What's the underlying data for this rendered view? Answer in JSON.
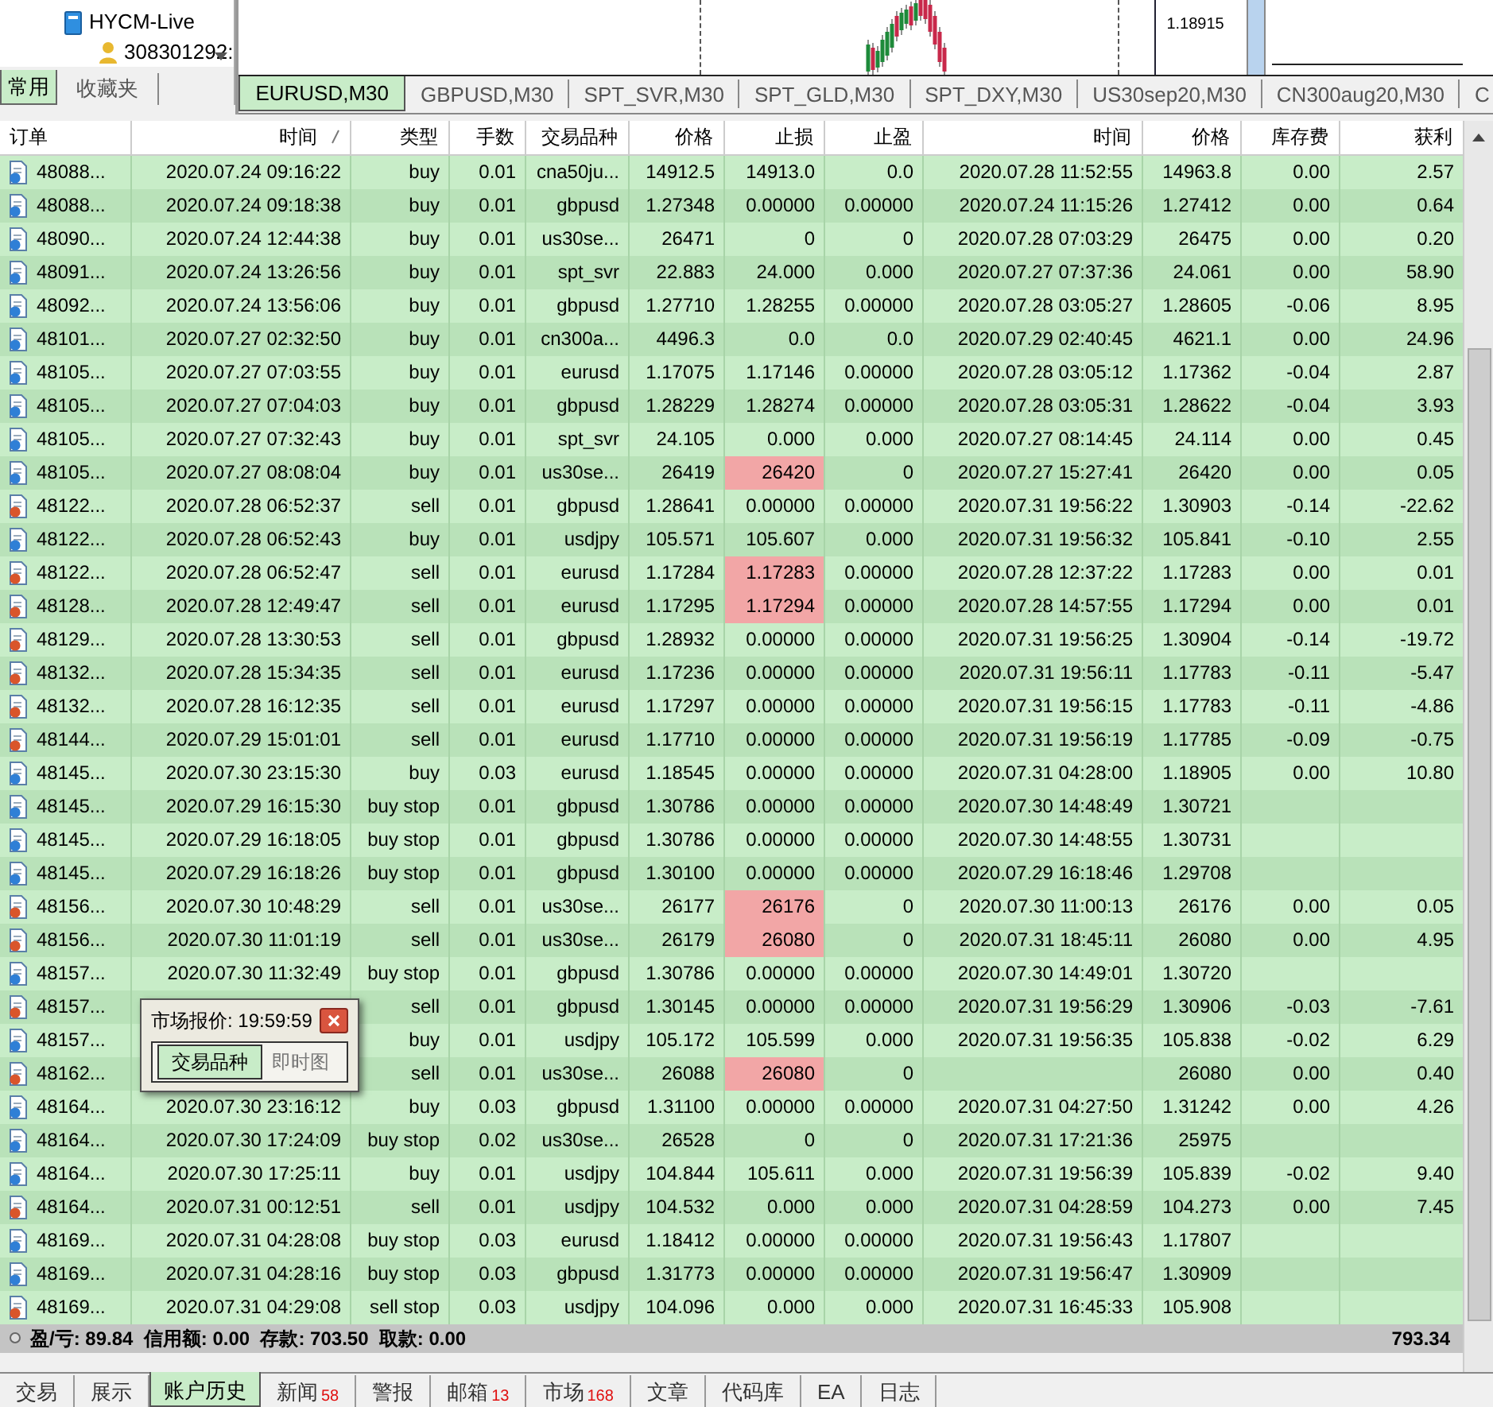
{
  "navigator": {
    "items": [
      {
        "label": "HYCM-Live",
        "kind": "server"
      },
      {
        "label": "308301292:",
        "kind": "account"
      }
    ],
    "tabs": [
      {
        "label": "常用",
        "selected": true
      },
      {
        "label": "收藏夹",
        "selected": false
      }
    ]
  },
  "chart": {
    "price_label": "1.18915"
  },
  "chart_tabs": [
    {
      "label": "EURUSD,M30",
      "selected": true
    },
    {
      "label": "GBPUSD,M30",
      "selected": false
    },
    {
      "label": "SPT_SVR,M30",
      "selected": false
    },
    {
      "label": "SPT_GLD,M30",
      "selected": false
    },
    {
      "label": "SPT_DXY,M30",
      "selected": false
    },
    {
      "label": "US30sep20,M30",
      "selected": false
    },
    {
      "label": "CN300aug20,M30",
      "selected": false
    },
    {
      "label": "C",
      "selected": false
    }
  ],
  "columns": [
    {
      "label": "订单",
      "sorted": false
    },
    {
      "label": "时间",
      "sorted": true
    },
    {
      "label": "类型",
      "sorted": false
    },
    {
      "label": "手数",
      "sorted": false
    },
    {
      "label": "交易品种",
      "sorted": false
    },
    {
      "label": "价格",
      "sorted": false
    },
    {
      "label": "止损",
      "sorted": false
    },
    {
      "label": "止盈",
      "sorted": false
    },
    {
      "label": "时间",
      "sorted": false
    },
    {
      "label": "价格",
      "sorted": false
    },
    {
      "label": "库存费",
      "sorted": false
    },
    {
      "label": "获利",
      "sorted": false
    }
  ],
  "rows": [
    {
      "kind": "buy",
      "order": "48088...",
      "time": "2020.07.24 09:16:22",
      "type": "buy",
      "lots": "0.01",
      "symbol": "cna50ju...",
      "price": "14912.5",
      "sl": "14913.0",
      "sl_hit": false,
      "tp": "0.0",
      "close_time": "2020.07.28 11:52:55",
      "close_price": "14963.8",
      "swap": "0.00",
      "profit": "2.57"
    },
    {
      "kind": "buy",
      "order": "48088...",
      "time": "2020.07.24 09:18:38",
      "type": "buy",
      "lots": "0.01",
      "symbol": "gbpusd",
      "price": "1.27348",
      "sl": "0.00000",
      "sl_hit": false,
      "tp": "0.00000",
      "close_time": "2020.07.24 11:15:26",
      "close_price": "1.27412",
      "swap": "0.00",
      "profit": "0.64"
    },
    {
      "kind": "buy",
      "order": "48090...",
      "time": "2020.07.24 12:44:38",
      "type": "buy",
      "lots": "0.01",
      "symbol": "us30se...",
      "price": "26471",
      "sl": "0",
      "sl_hit": false,
      "tp": "0",
      "close_time": "2020.07.28 07:03:29",
      "close_price": "26475",
      "swap": "0.00",
      "profit": "0.20"
    },
    {
      "kind": "buy",
      "order": "48091...",
      "time": "2020.07.24 13:26:56",
      "type": "buy",
      "lots": "0.01",
      "symbol": "spt_svr",
      "price": "22.883",
      "sl": "24.000",
      "sl_hit": false,
      "tp": "0.000",
      "close_time": "2020.07.27 07:37:36",
      "close_price": "24.061",
      "swap": "0.00",
      "profit": "58.90"
    },
    {
      "kind": "buy",
      "order": "48092...",
      "time": "2020.07.24 13:56:06",
      "type": "buy",
      "lots": "0.01",
      "symbol": "gbpusd",
      "price": "1.27710",
      "sl": "1.28255",
      "sl_hit": false,
      "tp": "0.00000",
      "close_time": "2020.07.28 03:05:27",
      "close_price": "1.28605",
      "swap": "-0.06",
      "profit": "8.95"
    },
    {
      "kind": "buy",
      "order": "48101...",
      "time": "2020.07.27 02:32:50",
      "type": "buy",
      "lots": "0.01",
      "symbol": "cn300a...",
      "price": "4496.3",
      "sl": "0.0",
      "sl_hit": false,
      "tp": "0.0",
      "close_time": "2020.07.29 02:40:45",
      "close_price": "4621.1",
      "swap": "0.00",
      "profit": "24.96"
    },
    {
      "kind": "buy",
      "order": "48105...",
      "time": "2020.07.27 07:03:55",
      "type": "buy",
      "lots": "0.01",
      "symbol": "eurusd",
      "price": "1.17075",
      "sl": "1.17146",
      "sl_hit": false,
      "tp": "0.00000",
      "close_time": "2020.07.28 03:05:12",
      "close_price": "1.17362",
      "swap": "-0.04",
      "profit": "2.87"
    },
    {
      "kind": "buy",
      "order": "48105...",
      "time": "2020.07.27 07:04:03",
      "type": "buy",
      "lots": "0.01",
      "symbol": "gbpusd",
      "price": "1.28229",
      "sl": "1.28274",
      "sl_hit": false,
      "tp": "0.00000",
      "close_time": "2020.07.28 03:05:31",
      "close_price": "1.28622",
      "swap": "-0.04",
      "profit": "3.93"
    },
    {
      "kind": "buy",
      "order": "48105...",
      "time": "2020.07.27 07:32:43",
      "type": "buy",
      "lots": "0.01",
      "symbol": "spt_svr",
      "price": "24.105",
      "sl": "0.000",
      "sl_hit": false,
      "tp": "0.000",
      "close_time": "2020.07.27 08:14:45",
      "close_price": "24.114",
      "swap": "0.00",
      "profit": "0.45"
    },
    {
      "kind": "buy",
      "order": "48105...",
      "time": "2020.07.27 08:08:04",
      "type": "buy",
      "lots": "0.01",
      "symbol": "us30se...",
      "price": "26419",
      "sl": "26420",
      "sl_hit": true,
      "tp": "0",
      "close_time": "2020.07.27 15:27:41",
      "close_price": "26420",
      "swap": "0.00",
      "profit": "0.05"
    },
    {
      "kind": "sell",
      "order": "48122...",
      "time": "2020.07.28 06:52:37",
      "type": "sell",
      "lots": "0.01",
      "symbol": "gbpusd",
      "price": "1.28641",
      "sl": "0.00000",
      "sl_hit": false,
      "tp": "0.00000",
      "close_time": "2020.07.31 19:56:22",
      "close_price": "1.30903",
      "swap": "-0.14",
      "profit": "-22.62"
    },
    {
      "kind": "buy",
      "order": "48122...",
      "time": "2020.07.28 06:52:43",
      "type": "buy",
      "lots": "0.01",
      "symbol": "usdjpy",
      "price": "105.571",
      "sl": "105.607",
      "sl_hit": false,
      "tp": "0.000",
      "close_time": "2020.07.31 19:56:32",
      "close_price": "105.841",
      "swap": "-0.10",
      "profit": "2.55"
    },
    {
      "kind": "sell",
      "order": "48122...",
      "time": "2020.07.28 06:52:47",
      "type": "sell",
      "lots": "0.01",
      "symbol": "eurusd",
      "price": "1.17284",
      "sl": "1.17283",
      "sl_hit": true,
      "tp": "0.00000",
      "close_time": "2020.07.28 12:37:22",
      "close_price": "1.17283",
      "swap": "0.00",
      "profit": "0.01"
    },
    {
      "kind": "sell",
      "order": "48128...",
      "time": "2020.07.28 12:49:47",
      "type": "sell",
      "lots": "0.01",
      "symbol": "eurusd",
      "price": "1.17295",
      "sl": "1.17294",
      "sl_hit": true,
      "tp": "0.00000",
      "close_time": "2020.07.28 14:57:55",
      "close_price": "1.17294",
      "swap": "0.00",
      "profit": "0.01"
    },
    {
      "kind": "sell",
      "order": "48129...",
      "time": "2020.07.28 13:30:53",
      "type": "sell",
      "lots": "0.01",
      "symbol": "gbpusd",
      "price": "1.28932",
      "sl": "0.00000",
      "sl_hit": false,
      "tp": "0.00000",
      "close_time": "2020.07.31 19:56:25",
      "close_price": "1.30904",
      "swap": "-0.14",
      "profit": "-19.72"
    },
    {
      "kind": "sell",
      "order": "48132...",
      "time": "2020.07.28 15:34:35",
      "type": "sell",
      "lots": "0.01",
      "symbol": "eurusd",
      "price": "1.17236",
      "sl": "0.00000",
      "sl_hit": false,
      "tp": "0.00000",
      "close_time": "2020.07.31 19:56:11",
      "close_price": "1.17783",
      "swap": "-0.11",
      "profit": "-5.47"
    },
    {
      "kind": "sell",
      "order": "48132...",
      "time": "2020.07.28 16:12:35",
      "type": "sell",
      "lots": "0.01",
      "symbol": "eurusd",
      "price": "1.17297",
      "sl": "0.00000",
      "sl_hit": false,
      "tp": "0.00000",
      "close_time": "2020.07.31 19:56:15",
      "close_price": "1.17783",
      "swap": "-0.11",
      "profit": "-4.86"
    },
    {
      "kind": "sell",
      "order": "48144...",
      "time": "2020.07.29 15:01:01",
      "type": "sell",
      "lots": "0.01",
      "symbol": "eurusd",
      "price": "1.17710",
      "sl": "0.00000",
      "sl_hit": false,
      "tp": "0.00000",
      "close_time": "2020.07.31 19:56:19",
      "close_price": "1.17785",
      "swap": "-0.09",
      "profit": "-0.75"
    },
    {
      "kind": "buy",
      "order": "48145...",
      "time": "2020.07.30 23:15:30",
      "type": "buy",
      "lots": "0.03",
      "symbol": "eurusd",
      "price": "1.18545",
      "sl": "0.00000",
      "sl_hit": false,
      "tp": "0.00000",
      "close_time": "2020.07.31 04:28:00",
      "close_price": "1.18905",
      "swap": "0.00",
      "profit": "10.80"
    },
    {
      "kind": "buy",
      "order": "48145...",
      "time": "2020.07.29 16:15:30",
      "type": "buy stop",
      "lots": "0.01",
      "symbol": "gbpusd",
      "price": "1.30786",
      "sl": "0.00000",
      "sl_hit": false,
      "tp": "0.00000",
      "close_time": "2020.07.30 14:48:49",
      "close_price": "1.30721"
    },
    {
      "kind": "buy",
      "order": "48145...",
      "time": "2020.07.29 16:18:05",
      "type": "buy stop",
      "lots": "0.01",
      "symbol": "gbpusd",
      "price": "1.30786",
      "sl": "0.00000",
      "sl_hit": false,
      "tp": "0.00000",
      "close_time": "2020.07.30 14:48:55",
      "close_price": "1.30731"
    },
    {
      "kind": "buy",
      "order": "48145...",
      "time": "2020.07.29 16:18:26",
      "type": "buy stop",
      "lots": "0.01",
      "symbol": "gbpusd",
      "price": "1.30100",
      "sl": "0.00000",
      "sl_hit": false,
      "tp": "0.00000",
      "close_time": "2020.07.29 16:18:46",
      "close_price": "1.29708"
    },
    {
      "kind": "sell",
      "order": "48156...",
      "time": "2020.07.30 10:48:29",
      "type": "sell",
      "lots": "0.01",
      "symbol": "us30se...",
      "price": "26177",
      "sl": "26176",
      "sl_hit": true,
      "tp": "0",
      "close_time": "2020.07.30 11:00:13",
      "close_price": "26176",
      "swap": "0.00",
      "profit": "0.05"
    },
    {
      "kind": "sell",
      "order": "48156...",
      "time": "2020.07.30 11:01:19",
      "type": "sell",
      "lots": "0.01",
      "symbol": "us30se...",
      "price": "26179",
      "sl": "26080",
      "sl_hit": true,
      "tp": "0",
      "close_time": "2020.07.31 18:45:11",
      "close_price": "26080",
      "swap": "0.00",
      "profit": "4.95"
    },
    {
      "kind": "buy",
      "order": "48157...",
      "time": "2020.07.30 11:32:49",
      "type": "buy stop",
      "lots": "0.01",
      "symbol": "gbpusd",
      "price": "1.30786",
      "sl": "0.00000",
      "sl_hit": false,
      "tp": "0.00000",
      "close_time": "2020.07.30 14:49:01",
      "close_price": "1.30720"
    },
    {
      "kind": "sell",
      "order": "48157...",
      "type": "sell",
      "lots": "0.01",
      "symbol": "gbpusd",
      "price": "1.30145",
      "sl": "0.00000",
      "sl_hit": false,
      "tp": "0.00000",
      "close_time": "2020.07.31 19:56:29",
      "close_price": "1.30906",
      "swap": "-0.03",
      "profit": "-7.61"
    },
    {
      "kind": "buy",
      "order": "48157...",
      "type": "buy",
      "lots": "0.01",
      "symbol": "usdjpy",
      "price": "105.172",
      "sl": "105.599",
      "sl_hit": false,
      "tp": "0.000",
      "close_time": "2020.07.31 19:56:35",
      "close_price": "105.838",
      "swap": "-0.02",
      "profit": "6.29"
    },
    {
      "kind": "sell",
      "order": "48162...",
      "type": "sell",
      "lots": "0.01",
      "symbol": "us30se...",
      "price": "26088",
      "sl": "26080",
      "sl_hit": true,
      "tp": "0",
      "close_price": "26080",
      "swap": "0.00",
      "profit": "0.40"
    },
    {
      "kind": "buy",
      "order": "48164...",
      "time": "2020.07.30 23:16:12",
      "type": "buy",
      "lots": "0.03",
      "symbol": "gbpusd",
      "price": "1.31100",
      "sl": "0.00000",
      "sl_hit": false,
      "tp": "0.00000",
      "close_time": "2020.07.31 04:27:50",
      "close_price": "1.31242",
      "swap": "0.00",
      "profit": "4.26"
    },
    {
      "kind": "buy",
      "order": "48164...",
      "time": "2020.07.30 17:24:09",
      "type": "buy stop",
      "lots": "0.02",
      "symbol": "us30se...",
      "price": "26528",
      "sl": "0",
      "sl_hit": false,
      "tp": "0",
      "close_time": "2020.07.31 17:21:36",
      "close_price": "25975"
    },
    {
      "kind": "buy",
      "order": "48164...",
      "time": "2020.07.30 17:25:11",
      "type": "buy",
      "lots": "0.01",
      "symbol": "usdjpy",
      "price": "104.844",
      "sl": "105.611",
      "sl_hit": false,
      "tp": "0.000",
      "close_time": "2020.07.31 19:56:39",
      "close_price": "105.839",
      "swap": "-0.02",
      "profit": "9.40"
    },
    {
      "kind": "sell",
      "order": "48164...",
      "time": "2020.07.31 00:12:51",
      "type": "sell",
      "lots": "0.01",
      "symbol": "usdjpy",
      "price": "104.532",
      "sl": "0.000",
      "sl_hit": false,
      "tp": "0.000",
      "close_time": "2020.07.31 04:28:59",
      "close_price": "104.273",
      "swap": "0.00",
      "profit": "7.45"
    },
    {
      "kind": "buy",
      "order": "48169...",
      "time": "2020.07.31 04:28:08",
      "type": "buy stop",
      "lots": "0.03",
      "symbol": "eurusd",
      "price": "1.18412",
      "sl": "0.00000",
      "sl_hit": false,
      "tp": "0.00000",
      "close_time": "2020.07.31 19:56:43",
      "close_price": "1.17807"
    },
    {
      "kind": "buy",
      "order": "48169...",
      "time": "2020.07.31 04:28:16",
      "type": "buy stop",
      "lots": "0.03",
      "symbol": "gbpusd",
      "price": "1.31773",
      "sl": "0.00000",
      "sl_hit": false,
      "tp": "0.00000",
      "close_time": "2020.07.31 19:56:47",
      "close_price": "1.30909"
    },
    {
      "kind": "sell",
      "order": "48169...",
      "time": "2020.07.31 04:29:08",
      "type": "sell stop",
      "lots": "0.03",
      "symbol": "usdjpy",
      "price": "104.096",
      "sl": "0.000",
      "sl_hit": false,
      "tp": "0.000",
      "close_time": "2020.07.31 16:45:33",
      "close_price": "105.908"
    }
  ],
  "summary": {
    "text": "盈/亏: 89.84  信用额: 0.00  存款: 703.50  取款: 0.00",
    "total": "793.34"
  },
  "popup": {
    "title": "市场报价: 19:59:59",
    "tabs": [
      {
        "label": "交易品种",
        "selected": true
      },
      {
        "label": "即时图",
        "selected": false
      }
    ]
  },
  "bottom_tabs": [
    {
      "label": "交易",
      "selected": false
    },
    {
      "label": "展示",
      "selected": false
    },
    {
      "label": "账户历史",
      "selected": true
    },
    {
      "label": "新闻",
      "count": "58",
      "selected": false
    },
    {
      "label": "警报",
      "selected": false
    },
    {
      "label": "邮箱",
      "count": "13",
      "selected": false
    },
    {
      "label": "市场",
      "count": "168",
      "selected": false
    },
    {
      "label": "文章",
      "selected": false
    },
    {
      "label": "代码库",
      "selected": false
    },
    {
      "label": "EA",
      "selected": false
    },
    {
      "label": "日志",
      "selected": false
    }
  ]
}
